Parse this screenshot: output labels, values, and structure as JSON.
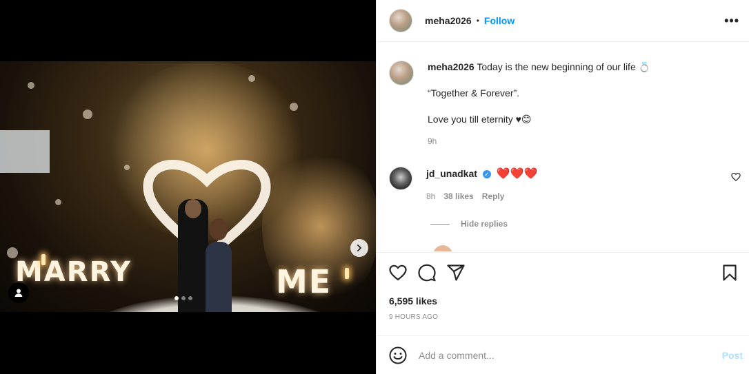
{
  "header": {
    "username": "meha2026",
    "bullet": "•",
    "follow_label": "Follow",
    "more_label": "•••"
  },
  "photo": {
    "letters_left": "MARRY",
    "letters_right": "ME",
    "carousel": {
      "total": 3,
      "current": 1
    }
  },
  "caption": {
    "username": "meha2026",
    "text": "Today is the new beginning of our life 💍",
    "line2": "“Together & Forever”.",
    "line3": "Love you till eternity ♥😊",
    "time": "9h"
  },
  "comment": {
    "username": "jd_unadkat",
    "verified_mark": "✓",
    "text": "❤️❤️❤️",
    "time": "8h",
    "likes": "38 likes",
    "reply_label": "Reply",
    "hide_replies": "Hide replies"
  },
  "stats": {
    "likes": "6,595 likes",
    "posted": "9 HOURS AGO"
  },
  "composer": {
    "placeholder": "Add a comment...",
    "post_label": "Post"
  },
  "icons": [
    "chevron-right-icon",
    "user-tag-icon",
    "heart-icon",
    "comment-icon",
    "share-icon",
    "bookmark-icon",
    "smile-icon",
    "more-icon",
    "verified-icon"
  ],
  "colors": {
    "link": "#0095f6",
    "post_disabled": "#b2dffc",
    "heart_red": "#e0201e",
    "muted": "#8e8e8e"
  }
}
